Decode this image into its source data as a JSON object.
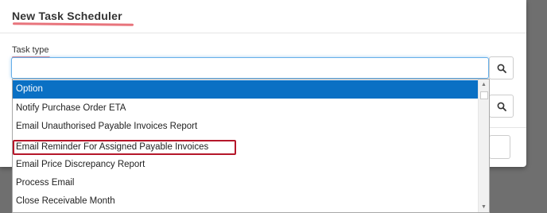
{
  "modal": {
    "title": "New Task Scheduler"
  },
  "task_type": {
    "label": "Task type",
    "value": "",
    "placeholder": ""
  },
  "icons": {
    "search": "search-icon",
    "scroll_up": "chevron-up-icon",
    "scroll_down": "chevron-down-icon"
  },
  "dropdown": {
    "options": [
      "Option",
      "Notify Purchase Order ETA",
      "Email Unauthorised Payable Invoices Report",
      "Email Reminder For Assigned Payable Invoices",
      "Email Price Discrepancy Report",
      "Process Email",
      "Close Receivable Month"
    ],
    "selected_index": 0,
    "annotated_index": 3
  },
  "colors": {
    "selected_bg": "#0a70c4",
    "annotation_red": "#b5172a",
    "underline_pink": "#e8747c",
    "focus_border": "#66afe9"
  }
}
